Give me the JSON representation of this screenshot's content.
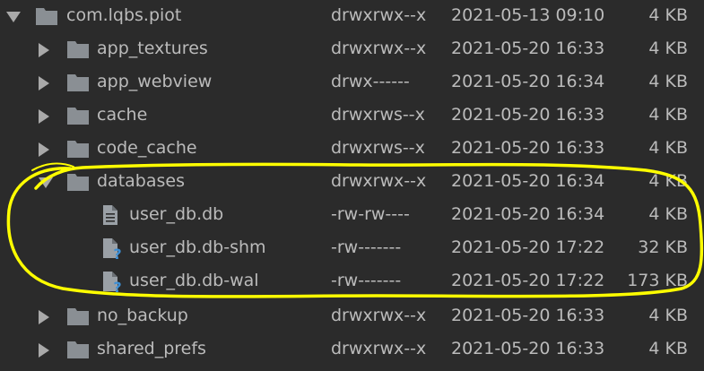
{
  "rows": [
    {
      "name": "com.lqbs.piot",
      "perms": "drwxrwx--x",
      "date": "2021-05-13 09:10",
      "size": "4 KB"
    },
    {
      "name": "app_textures",
      "perms": "drwxrwx--x",
      "date": "2021-05-20 16:33",
      "size": "4 KB"
    },
    {
      "name": "app_webview",
      "perms": "drwx------",
      "date": "2021-05-20 16:34",
      "size": "4 KB"
    },
    {
      "name": "cache",
      "perms": "drwxrws--x",
      "date": "2021-05-20 16:33",
      "size": "4 KB"
    },
    {
      "name": "code_cache",
      "perms": "drwxrws--x",
      "date": "2021-05-20 16:33",
      "size": "4 KB"
    },
    {
      "name": "databases",
      "perms": "drwxrwx--x",
      "date": "2021-05-20 16:34",
      "size": "4 KB"
    },
    {
      "name": "user_db.db",
      "perms": "-rw-rw----",
      "date": "2021-05-20 16:34",
      "size": "4 KB"
    },
    {
      "name": "user_db.db-shm",
      "perms": "-rw-------",
      "date": "2021-05-20 17:22",
      "size": "32 KB"
    },
    {
      "name": "user_db.db-wal",
      "perms": "-rw-------",
      "date": "2021-05-20 17:22",
      "size": "173 KB"
    },
    {
      "name": "no_backup",
      "perms": "drwxrwx--x",
      "date": "2021-05-20 16:33",
      "size": "4 KB"
    },
    {
      "name": "shared_prefs",
      "perms": "drwxrwx--x",
      "date": "2021-05-20 16:33",
      "size": "4 KB"
    }
  ],
  "colors": {
    "background": "#2b2b2b",
    "text": "#bbbbbb",
    "folder": "#8a8f94",
    "file": "#9aa0a6",
    "unknown_badge": "#3d8fd6",
    "highlight": "#ffff00"
  },
  "icons": {
    "folder": "folder-icon",
    "file": "file-icon",
    "unknown_file": "unknown-file-icon",
    "expanded": "chevron-down-icon",
    "collapsed": "chevron-right-icon"
  }
}
